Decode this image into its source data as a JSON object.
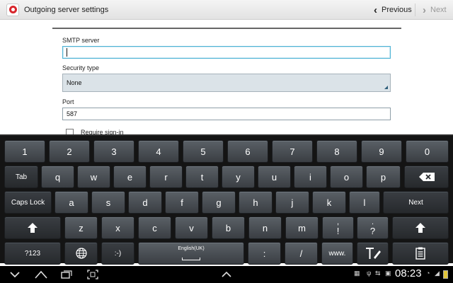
{
  "header": {
    "title": "Outgoing server settings",
    "previous_label": "Previous",
    "next_label": "Next"
  },
  "form": {
    "smtp_label": "SMTP server",
    "smtp_value": "",
    "security_label": "Security type",
    "security_value": "None",
    "port_label": "Port",
    "port_value": "587",
    "require_signin_label": "Require sign-in"
  },
  "keyboard": {
    "row1": [
      "1",
      "2",
      "3",
      "4",
      "5",
      "6",
      "7",
      "8",
      "9",
      "0"
    ],
    "row2_left": "Tab",
    "row2": [
      "q",
      "w",
      "e",
      "r",
      "t",
      "y",
      "u",
      "i",
      "o",
      "p"
    ],
    "row3_left": "Caps Lock",
    "row3": [
      "a",
      "s",
      "d",
      "f",
      "g",
      "h",
      "j",
      "k",
      "l"
    ],
    "row3_right": "Next",
    "row4": [
      "z",
      "x",
      "c",
      "v",
      "b",
      "n",
      "m",
      "!",
      "?"
    ],
    "row4_top": {
      "excl": ",",
      "quest": "."
    },
    "row5": {
      "sym": "?123",
      "smiley": ":-)",
      "space": "English(UK)",
      "colon": ":",
      "slash": "/",
      "www": "www."
    },
    "shift_icon": "up-arrow-icon",
    "backspace_icon": "backspace-icon",
    "globe_icon": "globe-icon",
    "handwriting_icon": "handwriting-icon",
    "clipboard_icon": "clipboard-icon"
  },
  "statusbar": {
    "time": "08:23"
  },
  "colors": {
    "accent": "#4fb4d6",
    "brand": "#d8262c"
  }
}
